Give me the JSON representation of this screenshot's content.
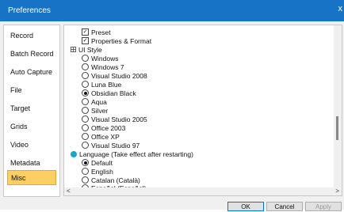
{
  "window": {
    "title": "Preferences",
    "close_glyph": "x"
  },
  "sidebar": {
    "items": [
      {
        "label": "Record",
        "active": false
      },
      {
        "label": "Batch Record",
        "active": false
      },
      {
        "label": "Auto Capture",
        "active": false
      },
      {
        "label": "File",
        "active": false
      },
      {
        "label": "Target",
        "active": false
      },
      {
        "label": "Grids",
        "active": false
      },
      {
        "label": "Video",
        "active": false
      },
      {
        "label": "Metadata",
        "active": false
      },
      {
        "label": "Misc",
        "active": true
      }
    ]
  },
  "settings": {
    "preset": {
      "label": "Preset",
      "checked": true
    },
    "properties_format": {
      "label": "Properties & Format",
      "checked": true
    },
    "ui_style": {
      "label": "UI Style",
      "icon": "grid-group-icon",
      "options": [
        {
          "label": "Windows",
          "selected": false
        },
        {
          "label": "Windows 7",
          "selected": false
        },
        {
          "label": "Visual Studio 2008",
          "selected": false
        },
        {
          "label": "Luna Blue",
          "selected": false
        },
        {
          "label": "Obsidian Black",
          "selected": true
        },
        {
          "label": "Aqua",
          "selected": false
        },
        {
          "label": "Silver",
          "selected": false
        },
        {
          "label": "Visual Studio 2005",
          "selected": false
        },
        {
          "label": "Office 2003",
          "selected": false
        },
        {
          "label": "Office XP",
          "selected": false
        },
        {
          "label": "Visual Studio 97",
          "selected": false
        }
      ]
    },
    "language": {
      "label": "Language (Take effect after restarting)",
      "icon": "globe-icon",
      "options": [
        {
          "label": "Default",
          "selected": true
        },
        {
          "label": "English",
          "selected": false
        },
        {
          "label": "Catalan (Català)",
          "selected": false
        },
        {
          "label": "Espaῆol (Espaῆol)",
          "selected": false
        }
      ]
    }
  },
  "scroll": {
    "left_arrow": "<",
    "right_arrow": ">"
  },
  "buttons": {
    "ok": "OK",
    "cancel": "Cancel",
    "apply": "Apply"
  },
  "colors": {
    "titlebar": "#1673c6",
    "active_item": "#fbcf63",
    "language_icon": "#19a7c6"
  }
}
